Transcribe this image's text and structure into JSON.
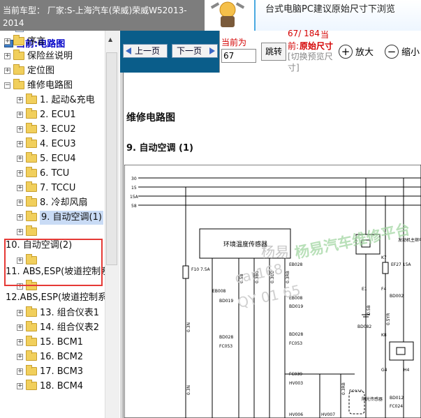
{
  "header": {
    "car_label": "当前车型：  厂家:S-上海汽车(荣威)荣威W52013-2014",
    "banner": "台式电脑PC建议原始尺寸下浏览"
  },
  "tree": {
    "root": "当前:电路图",
    "items": [
      {
        "label": "目录",
        "type": "doc"
      },
      {
        "label": "序言",
        "type": "folder"
      },
      {
        "label": "保险丝说明",
        "type": "folder"
      },
      {
        "label": "定位图",
        "type": "folder"
      },
      {
        "label": "维修电路图",
        "type": "folder"
      },
      {
        "label": "1. 起动&充电",
        "type": "folder"
      },
      {
        "label": "2. ECU1",
        "type": "folder"
      },
      {
        "label": "3. ECU2",
        "type": "folder"
      },
      {
        "label": "4. ECU3",
        "type": "folder"
      },
      {
        "label": "5. ECU4",
        "type": "folder"
      },
      {
        "label": "6. TCU",
        "type": "folder"
      },
      {
        "label": "7. TCCU",
        "type": "folder"
      },
      {
        "label": "8. 冷却风扇",
        "type": "folder"
      },
      {
        "label": "9. 自动空调(1)",
        "type": "folder",
        "selected": true
      },
      {
        "label": "",
        "type": "folder"
      },
      {
        "label": "10. 自动空调(2)",
        "type": "text"
      },
      {
        "label": "",
        "type": "folder"
      },
      {
        "label": "11. ABS,ESP(坡道控制系",
        "type": "text"
      },
      {
        "label": "",
        "type": "folder"
      },
      {
        "label": "12.ABS,ESP(坡道控制系统",
        "type": "text"
      },
      {
        "label": "13. 组合仪表1",
        "type": "folder"
      },
      {
        "label": "14. 组合仪表2",
        "type": "folder"
      },
      {
        "label": "15. BCM1",
        "type": "folder"
      },
      {
        "label": "16. BCM2",
        "type": "folder"
      },
      {
        "label": "17. BCM3",
        "type": "folder"
      },
      {
        "label": "18. BCM4",
        "type": "folder"
      }
    ]
  },
  "toolbar": {
    "prev": "上一页",
    "next": "下一页",
    "current_label": "当前为",
    "page_value": "67",
    "jump": "跳转",
    "page_counter": "67/ 184",
    "current_word": "当",
    "front_word": "前:",
    "original_size": "原始尺寸",
    "toggle_hint": "[切换预览尺寸]",
    "zoom_in": "放大",
    "zoom_out": "缩小"
  },
  "document": {
    "title": "维修电路图",
    "section": "9. 自动空调 (1)",
    "watermark": "杨易汽车维修平台",
    "watermark2": "杨易",
    "watermark3": "car168",
    "watermark4": "QY 01 65",
    "rail_labels": [
      "30",
      "15",
      "15A",
      "58"
    ],
    "sensor_label": "环境温度传感器",
    "fuse_label": "F10 7.5A",
    "ef_label": "EF27 15A",
    "relay_label": "发动机主继电器",
    "sun_sensor": "阳光传感器",
    "connectors": [
      "EB008",
      "BD019",
      "BD028",
      "FC053",
      "EB028",
      "EB008",
      "BD019",
      "BD028",
      "FC053",
      "FC039",
      "HV003",
      "FC010",
      "FC024",
      "BD002",
      "BD012",
      "BD082",
      "K8",
      "G4",
      "H4",
      "K7",
      "E1",
      "F4",
      "HV006",
      "HV007"
    ],
    "wire_labels": [
      "0.3N",
      "0.5B",
      "0.3BG",
      "0.3UB",
      "0.3RB",
      "0.5YR",
      "0.3RB",
      "0.3N",
      "0.5B"
    ]
  }
}
